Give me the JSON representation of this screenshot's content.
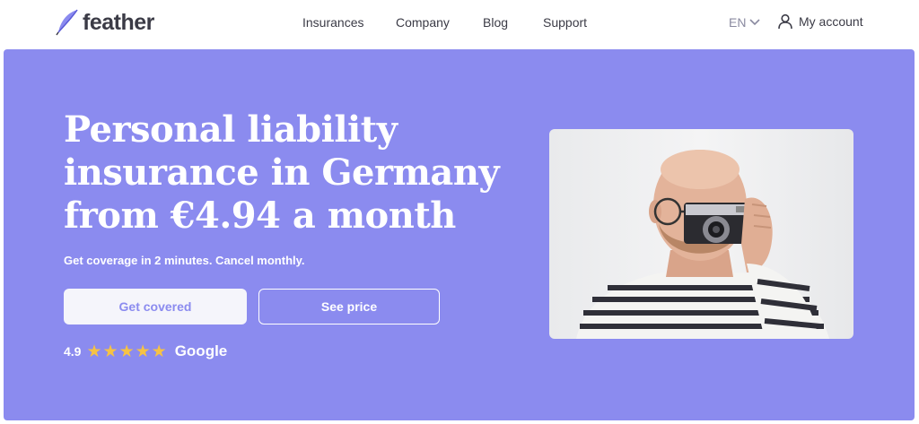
{
  "brand": {
    "name": "feather"
  },
  "nav": {
    "links": [
      "Insurances",
      "Company",
      "Blog",
      "Support"
    ],
    "language": "EN",
    "account_label": "My account"
  },
  "hero": {
    "headline": "Personal liability insurance in Germany from €4.94 a month",
    "subheadline": "Get coverage in 2 minutes. Cancel monthly.",
    "primary_button": "Get covered",
    "secondary_button": "See price",
    "rating": {
      "score": "4.9",
      "stars": 5,
      "provider": "Google"
    }
  },
  "colors": {
    "hero_background": "#8b8bef",
    "star": "#f6c244",
    "nav_text": "#3b3b46"
  },
  "icons": [
    "feather-logo-icon",
    "chevron-down-icon",
    "user-icon",
    "star-icon"
  ]
}
